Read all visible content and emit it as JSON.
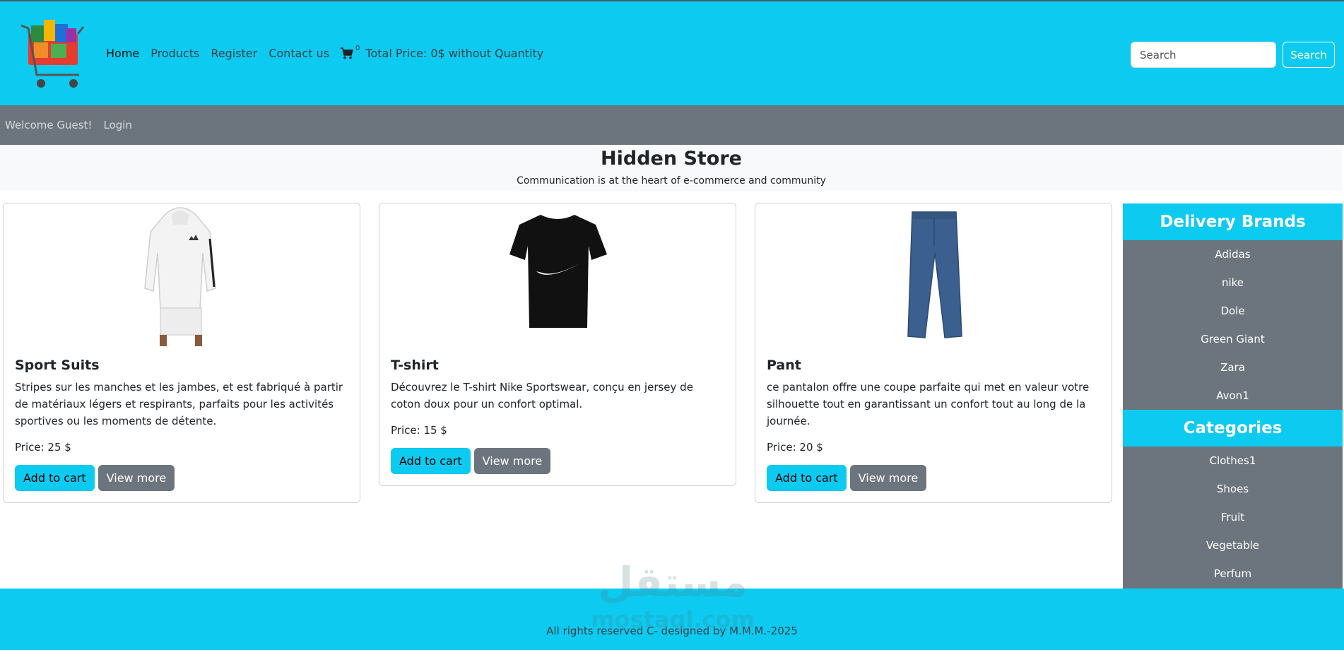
{
  "nav": {
    "home": "Home",
    "products": "Products",
    "register": "Register",
    "contact": "Contact us",
    "cart_count": "0",
    "total_price": "Total Price: 0$ without Quantity"
  },
  "search": {
    "placeholder": "Search",
    "button": "Search"
  },
  "welcome": {
    "text": "Welcome Guest!",
    "login": "Login"
  },
  "hero": {
    "title": "Hidden Store",
    "subtitle": "Communication is at the heart of e-commerce and community"
  },
  "products": [
    {
      "title": "Sport Suits",
      "description": "Stripes sur les manches et les jambes, et est fabriqué à partir de matériaux légers et respirants, parfaits pour les activités sportives ou les moments de détente.",
      "price": "Price: 25 $",
      "add": "Add to cart",
      "more": "View more"
    },
    {
      "title": "T-shirt",
      "description": "Découvrez le T-shirt Nike Sportswear, conçu en jersey de coton doux pour un confort optimal.",
      "price": "Price: 15 $",
      "add": "Add to cart",
      "more": "View more"
    },
    {
      "title": "Pant",
      "description": "ce pantalon offre une coupe parfaite qui met en valeur votre silhouette tout en garantissant un confort tout au long de la journée.",
      "price": "Price: 20 $",
      "add": "Add to cart",
      "more": "View more"
    }
  ],
  "sidebar": {
    "brands_title": "Delivery Brands",
    "brands": [
      "Adidas",
      "nike",
      "Dole",
      "Green Giant",
      "Zara",
      "Avon1"
    ],
    "categories_title": "Categories",
    "categories": [
      "Clothes1",
      "Shoes",
      "Fruit",
      "Vegetable",
      "Perfum"
    ]
  },
  "footer": {
    "text": "All rights reserved C- designed by M.M.M.-2025"
  },
  "watermark": {
    "arabic": "مستقل",
    "latin": "mostaql.com"
  },
  "colors": {
    "accent": "#0dcaf0",
    "secondary": "#6c757d",
    "light": "#f8f9fa"
  }
}
